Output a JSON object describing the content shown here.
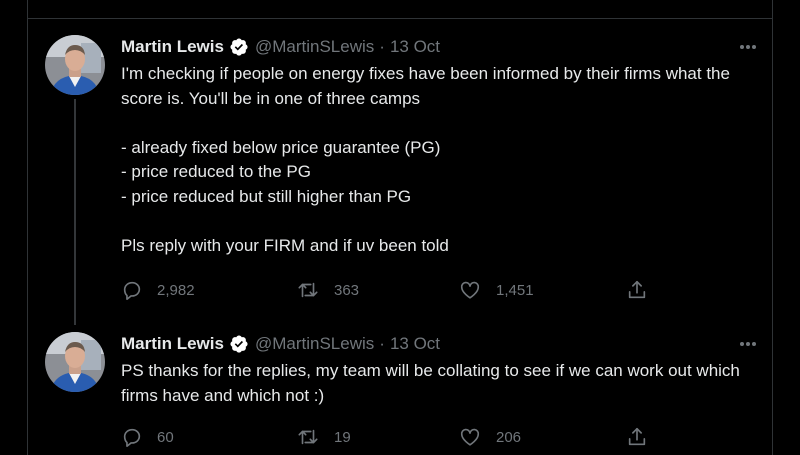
{
  "colors": {
    "background": "#000000",
    "text": "#e7e9ea",
    "muted": "#71767b",
    "verified": "#ffffff",
    "divider": "#2f3336"
  },
  "tweets": [
    {
      "author_name": "Martin Lewis",
      "handle": "@MartinSLewis",
      "separator": "·",
      "date": "13 Oct",
      "verified_icon": "verified-badge-icon",
      "text": "I'm checking if people on energy fixes have been informed by their firms what the score is. You'll be in one of three camps\n\n- already fixed below price guarantee (PG)\n- price reduced to the PG\n- price reduced but still higher than PG\n\nPls reply with your FIRM and if uv been told",
      "replies": "2,982",
      "retweets": "363",
      "likes": "1,451"
    },
    {
      "author_name": "Martin Lewis",
      "handle": "@MartinSLewis",
      "separator": "·",
      "date": "13 Oct",
      "verified_icon": "verified-badge-icon",
      "text": "PS thanks for the replies, my team will be collating to see if we can work out which firms have and which not :)",
      "replies": "60",
      "retweets": "19",
      "likes": "206"
    }
  ]
}
